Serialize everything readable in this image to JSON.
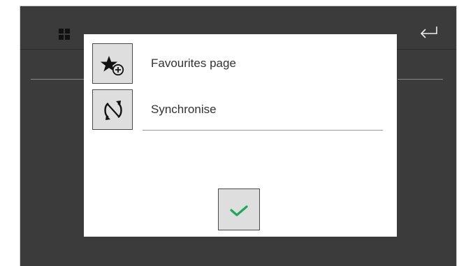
{
  "topbar": {
    "icons": [
      "grid-icon",
      "minus-icon",
      "enter-icon"
    ]
  },
  "dialog": {
    "items": [
      {
        "label": "Favourites page",
        "icon": "star-add-icon"
      },
      {
        "label": "Synchronise",
        "icon": "sync-icon"
      }
    ],
    "confirm": {
      "icon": "checkmark-icon",
      "color": "#1fa85a"
    }
  },
  "colors": {
    "background": "#3b3b3b",
    "dialog": "#ffffff",
    "button": "#dedede",
    "text": "#333333"
  }
}
